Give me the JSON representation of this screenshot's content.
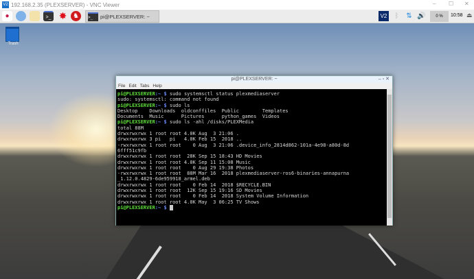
{
  "window": {
    "title": "192.168.2.35 (PLEXSERVER) - VNC Viewer",
    "logo": "V2",
    "minimize": "–",
    "maximize": "☐",
    "close": "✕"
  },
  "taskbar": {
    "task_label": "pi@PLEXSERVER: ~",
    "cpu": "0 %",
    "clock": "10:58",
    "vnc_logo": "V2"
  },
  "desktop": {
    "trash_label": "Trash"
  },
  "terminal": {
    "title": "pi@PLEXSERVER: ~",
    "menu": [
      "File",
      "Edit",
      "Tabs",
      "Help"
    ],
    "prompt_user": "pi@PLEXSERVER",
    "prompt_dir": ":~ $",
    "lines": [
      {
        "prompt": true,
        "text": " sudo systemsctl status plexmediaserver"
      },
      {
        "prompt": false,
        "text": "sudo: systemsctl: command not found"
      },
      {
        "prompt": true,
        "text": " sudo ls"
      },
      {
        "prompt": false,
        "text": "Desktop    Downloads  oldconffiles  Public        Templates"
      },
      {
        "prompt": false,
        "text": "Documents  Music      Pictures      python_games  Videos"
      },
      {
        "prompt": true,
        "text": " sudo ls -ahl /disks/PLEXMedia"
      },
      {
        "prompt": false,
        "text": "total 88M"
      },
      {
        "prompt": false,
        "text": "drwxrwxrwx 1 root root 4.0K Aug  3 21:06 ."
      },
      {
        "prompt": false,
        "text": "drwxrwxrwx 3 pi   pi   4.0K Feb 15  2018 .."
      },
      {
        "prompt": false,
        "text": "-rwxrwxrwx 1 root root    0 Aug  3 21:06 .device_info_2814d862-101a-4e98-a80d-8d"
      },
      {
        "prompt": false,
        "text": "6fff51c9fb"
      },
      {
        "prompt": false,
        "text": "drwxrwxrwx 1 root root  28K Sep 15 18:43 HD Movies"
      },
      {
        "prompt": false,
        "text": "drwxrwxrwx 1 root root 4.0K Sep 11 15:08 Music"
      },
      {
        "prompt": false,
        "text": "drwxrwxrwx 1 root root    0 Aug 29 19:38 Photos"
      },
      {
        "prompt": false,
        "text": "-rwxrwxrwx 1 root root  88M Mar 16  2018 plexmediaserver-ros6-binaries-annapurna"
      },
      {
        "prompt": false,
        "text": "_1.12.0.4829-6de959918_armel.deb"
      },
      {
        "prompt": false,
        "text": "drwxrwxrwx 1 root root    0 Feb 14  2018 $RECYCLE.BIN"
      },
      {
        "prompt": false,
        "text": "drwxrwxrwx 1 root root  12K Sep 15 19:16 SD Movies"
      },
      {
        "prompt": false,
        "text": "drwxrwxrwx 1 root root    0 Feb 14  2018 System Volume Information"
      },
      {
        "prompt": false,
        "text": "drwxrwxrwx 1 root root 4.0K May  3 06:25 TV Shows"
      },
      {
        "prompt": true,
        "text": " "
      }
    ]
  }
}
